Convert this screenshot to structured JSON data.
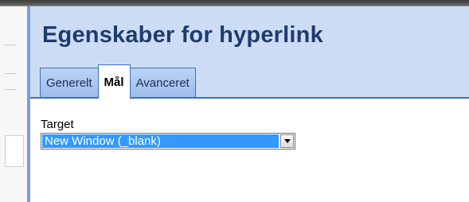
{
  "dialog": {
    "title": "Egenskaber for hyperlink",
    "tabs": [
      {
        "label": "Generelt",
        "active": false
      },
      {
        "label": "Mål",
        "active": true
      },
      {
        "label": "Avanceret",
        "active": false
      }
    ]
  },
  "target": {
    "label": "Target",
    "selected_value": "New Window (_blank)"
  },
  "colors": {
    "header_bg": "#ccdcf4",
    "title_text": "#1f3b6e",
    "selection": "#3399ff"
  },
  "icons": {
    "dropdown": "chevron-down-icon"
  }
}
